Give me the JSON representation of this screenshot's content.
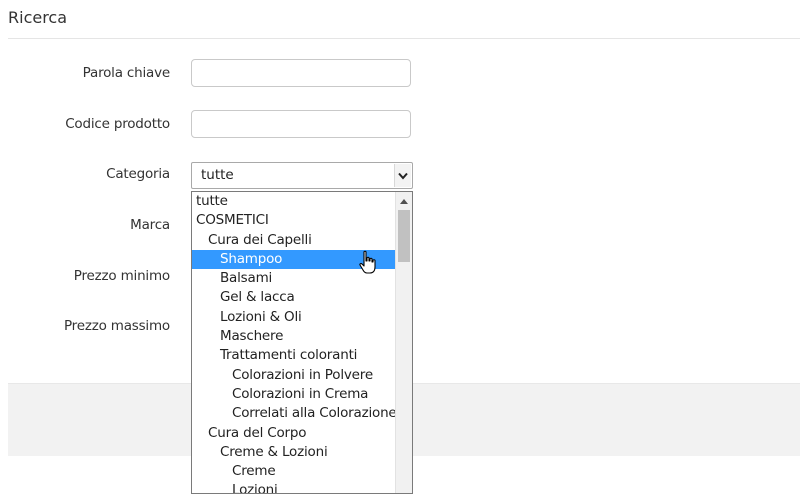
{
  "page": {
    "title": "Ricerca"
  },
  "form": {
    "keyword_label": "Parola chiave",
    "keyword_value": "",
    "code_label": "Codice prodotto",
    "code_value": "",
    "category_label": "Categoria",
    "category_value": "tutte",
    "brand_label": "Marca",
    "min_price_label": "Prezzo minimo",
    "max_price_label": "Prezzo massimo"
  },
  "dropdown": {
    "options": [
      {
        "label": "tutte",
        "level": 0
      },
      {
        "label": "COSMETICI",
        "level": 0
      },
      {
        "label": "Cura dei Capelli",
        "level": 1
      },
      {
        "label": "Shampoo",
        "level": 2,
        "selected": true
      },
      {
        "label": "Balsami",
        "level": 2
      },
      {
        "label": "Gel & lacca",
        "level": 2
      },
      {
        "label": "Lozioni & Oli",
        "level": 2
      },
      {
        "label": "Maschere",
        "level": 2
      },
      {
        "label": "Trattamenti coloranti",
        "level": 2
      },
      {
        "label": "Colorazioni in Polvere",
        "level": 3
      },
      {
        "label": "Colorazioni in Crema",
        "level": 3
      },
      {
        "label": "Correlati alla Colorazione",
        "level": 3
      },
      {
        "label": "Cura del Corpo",
        "level": 1
      },
      {
        "label": "Creme & Lozioni",
        "level": 2
      },
      {
        "label": "Creme",
        "level": 3
      },
      {
        "label": "Lozioni",
        "level": 3
      }
    ]
  },
  "icons": {
    "select_arrow": "chevron-down-icon",
    "scroll_up": "arrow-up-icon",
    "cursor": "hand-pointer-icon"
  },
  "colors": {
    "selected_bg": "#3399ff",
    "band_bg": "#f2f2f2"
  }
}
